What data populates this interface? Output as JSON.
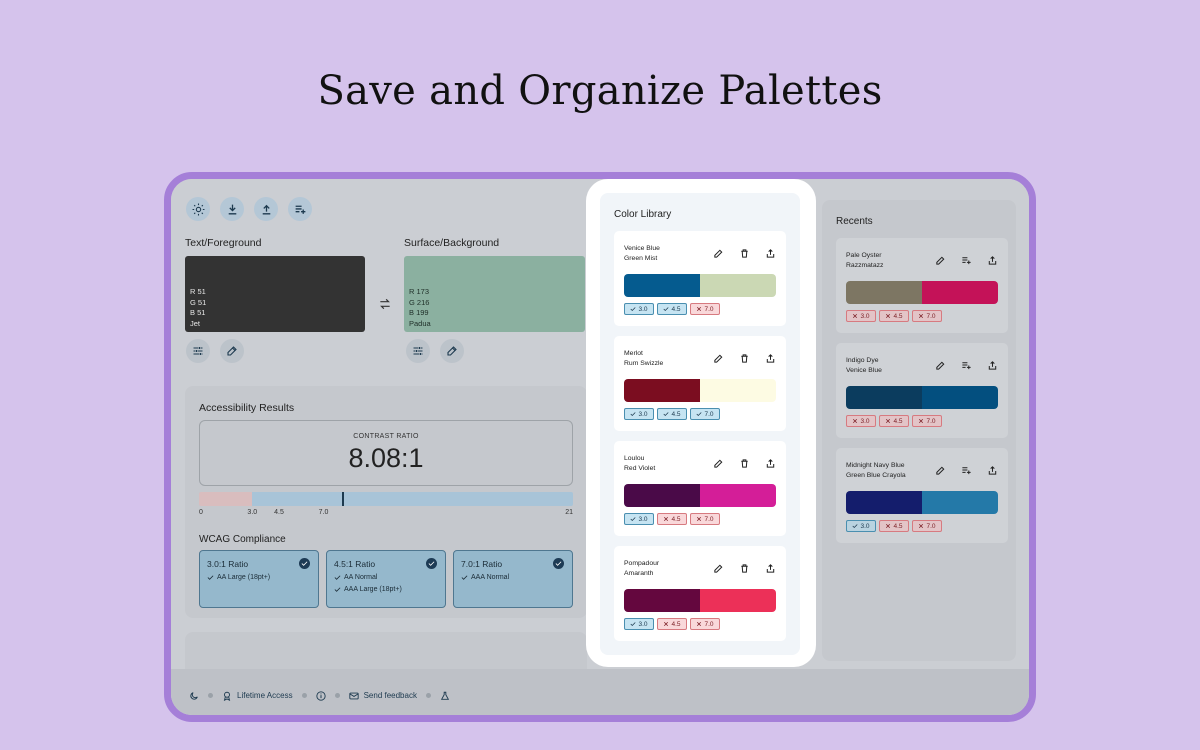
{
  "page_title": "Save and Organize Palettes",
  "toolbar": [
    "sun-icon",
    "download-icon",
    "upload-icon",
    "playlist-add-icon"
  ],
  "foreground": {
    "label": "Text/Foreground",
    "r": "R 51",
    "g": "G 51",
    "b": "B 51",
    "name": "Jet",
    "color": "#333333"
  },
  "background": {
    "label": "Surface/Background",
    "r": "R 173",
    "g": "G 216",
    "b": "B 199",
    "name": "Padua",
    "color": "#8bb0a0"
  },
  "accessibility": {
    "title": "Accessibility Results",
    "ratio_label": "CONTRAST RATIO",
    "ratio_value": "8.08:1",
    "ratio_number": 8.08,
    "scale_max": 21,
    "ticks": [
      {
        "label": "0",
        "v": 0
      },
      {
        "label": "3.0",
        "v": 3
      },
      {
        "label": "4.5",
        "v": 4.5
      },
      {
        "label": "7.0",
        "v": 7
      },
      {
        "label": "21",
        "v": 21
      }
    ],
    "wcag_title": "WCAG Compliance",
    "wcag": [
      {
        "title": "3.0:1 Ratio",
        "lines": [
          "AA Large (18pt+)"
        ]
      },
      {
        "title": "4.5:1 Ratio",
        "lines": [
          "AA Normal",
          "AAA Large (18pt+)"
        ]
      },
      {
        "title": "7.0:1 Ratio",
        "lines": [
          "AAA Normal"
        ]
      }
    ]
  },
  "library": {
    "title": "Color Library",
    "palettes": [
      {
        "line1": "Venice Blue",
        "line2": "Green Mist",
        "c1": "#055b8f",
        "c2": "#cbd8b4",
        "badges": [
          [
            "3.0",
            true
          ],
          [
            "4.5",
            true
          ],
          [
            "7.0",
            false
          ]
        ]
      },
      {
        "line1": "Merlot",
        "line2": "Rum Swizzle",
        "c1": "#7b0d20",
        "c2": "#fdfbe3",
        "badges": [
          [
            "3.0",
            true
          ],
          [
            "4.5",
            true
          ],
          [
            "7.0",
            true
          ]
        ]
      },
      {
        "line1": "Loulou",
        "line2": "Red Violet",
        "c1": "#4a0a48",
        "c2": "#d41e98",
        "badges": [
          [
            "3.0",
            true
          ],
          [
            "4.5",
            false
          ],
          [
            "7.0",
            false
          ]
        ]
      },
      {
        "line1": "Pompadour",
        "line2": "Amaranth",
        "c1": "#64073e",
        "c2": "#ec3058",
        "badges": [
          [
            "3.0",
            true
          ],
          [
            "4.5",
            false
          ],
          [
            "7.0",
            false
          ]
        ]
      }
    ]
  },
  "recents": {
    "title": "Recents",
    "palettes": [
      {
        "line1": "Pale Oyster",
        "line2": "Razzmatazz",
        "c1": "#7d7663",
        "c2": "#c41258",
        "badges": [
          [
            "3.0",
            false
          ],
          [
            "4.5",
            false
          ],
          [
            "7.0",
            false
          ]
        ]
      },
      {
        "line1": "Indigo Dye",
        "line2": "Venice Blue",
        "c1": "#0b3c5e",
        "c2": "#034f7f",
        "badges": [
          [
            "3.0",
            false
          ],
          [
            "4.5",
            false
          ],
          [
            "7.0",
            false
          ]
        ]
      },
      {
        "line1": "Midnight Navy Blue",
        "line2": "Green Blue Crayola",
        "c1": "#141d6c",
        "c2": "#2479a8",
        "badges": [
          [
            "3.0",
            true
          ],
          [
            "4.5",
            false
          ],
          [
            "7.0",
            false
          ]
        ]
      }
    ]
  },
  "status_bar": {
    "lifetime": "Lifetime Access",
    "feedback": "Send feedback"
  }
}
